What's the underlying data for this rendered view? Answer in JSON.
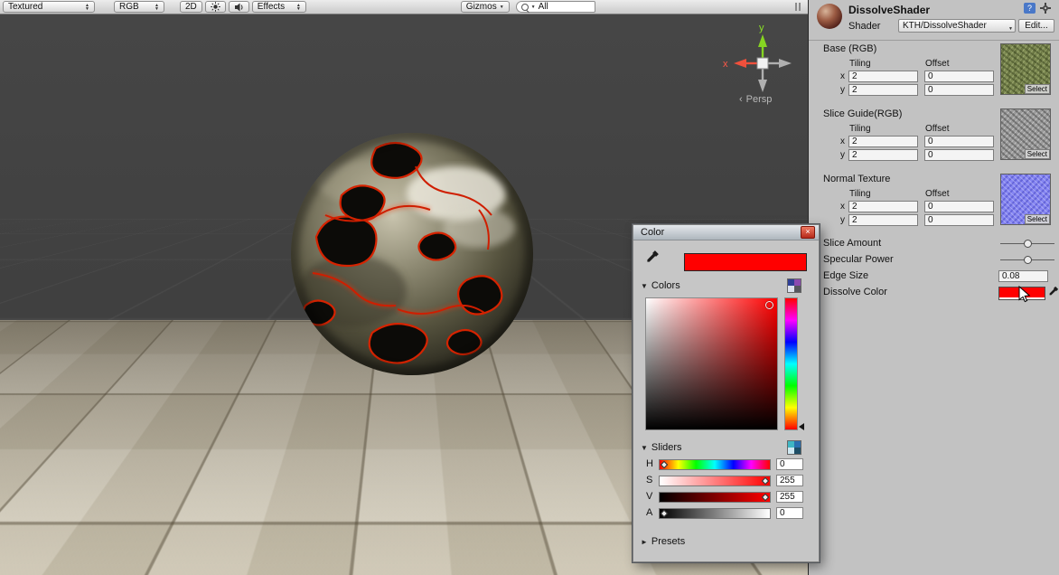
{
  "icons": {
    "up": "▲",
    "down": "▼",
    "close": "×",
    "foldout_open": "▼",
    "foldout_closed": "►",
    "help": "?",
    "persp_cone": "‹"
  },
  "scene_view": {
    "toolbar": {
      "shading": "Textured",
      "channels": "RGB",
      "toggle_2d": "2D",
      "effects": "Effects",
      "gizmos": "Gizmos",
      "search": "All"
    },
    "gizmo": {
      "y": "y",
      "x": "x",
      "persp": "Persp"
    }
  },
  "inspector": {
    "material_name": "DissolveShader",
    "shader_label": "Shader",
    "shader_name": "KTH/DissolveShader",
    "edit_button": "Edit...",
    "texture_sections": [
      {
        "title": "Base (RGB)",
        "tiling": "Tiling",
        "offset": "Offset",
        "row_x": "x",
        "row_y": "y",
        "tiling_x": "2",
        "tiling_y": "2",
        "offset_x": "0",
        "offset_y": "0",
        "select": "Select"
      },
      {
        "title": "Slice Guide(RGB)",
        "tiling": "Tiling",
        "offset": "Offset",
        "row_x": "x",
        "row_y": "y",
        "tiling_x": "2",
        "tiling_y": "2",
        "offset_x": "0",
        "offset_y": "0",
        "select": "Select"
      },
      {
        "title": "Normal Texture",
        "tiling": "Tiling",
        "offset": "Offset",
        "row_x": "x",
        "row_y": "y",
        "tiling_x": "2",
        "tiling_y": "2",
        "offset_x": "0",
        "offset_y": "0",
        "select": "Select"
      }
    ],
    "props": {
      "slice_amount": "Slice Amount",
      "specular_power": "Specular Power",
      "edge_size": "Edge Size",
      "edge_size_value": "0.08",
      "dissolve_color": "Dissolve Color",
      "dissolve_color_hex": "#ff0000"
    }
  },
  "color_window": {
    "title": "Color",
    "sections": {
      "colors": "Colors",
      "sliders": "Sliders",
      "presets": "Presets"
    },
    "current_color": "#ff0000",
    "sliders": [
      {
        "label": "H",
        "value": "0"
      },
      {
        "label": "S",
        "value": "255"
      },
      {
        "label": "V",
        "value": "255"
      },
      {
        "label": "A",
        "value": "0"
      }
    ]
  }
}
